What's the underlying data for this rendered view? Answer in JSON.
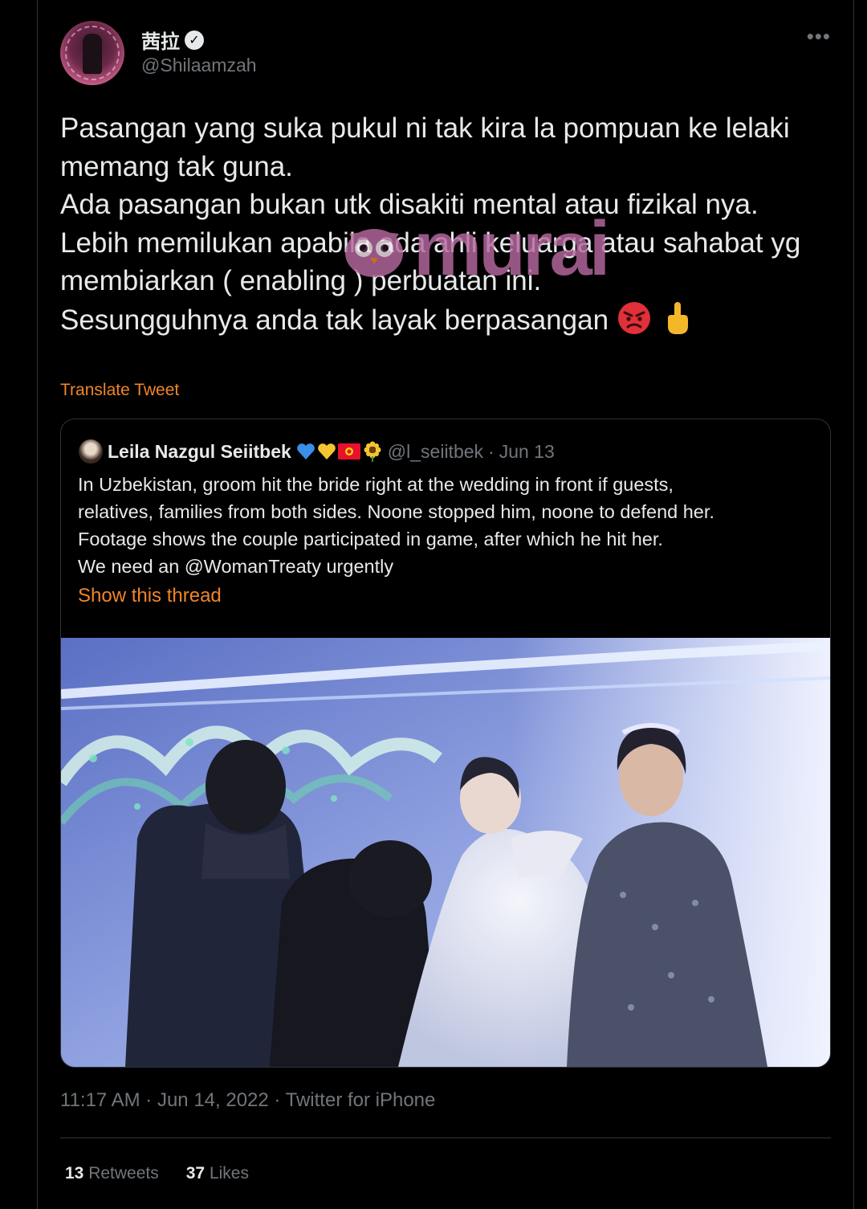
{
  "author": {
    "display_name": "茜拉",
    "handle": "@Shilaamzah",
    "verified": true,
    "avatar_icon": "profile-photo",
    "more_label": "•••"
  },
  "tweet": {
    "lines": [
      "Pasangan yang suka pukul ni tak kira la pompuan ke lelaki memang tak guna.",
      "Ada pasangan bukan utk disakiti mental atau fizikal nya.",
      "Lebih memilukan apabila ada ahli keluarga atau sahabat yg membiarkan ( enabling ) perbuatan ini.",
      "Sesungguhnya anda tak layak berpasangan"
    ],
    "emojis": [
      "angry-face-icon",
      "middle-finger-icon"
    ],
    "translate_label": "Translate Tweet"
  },
  "watermark": {
    "text": "murai",
    "icon": "owl-logo"
  },
  "quoted": {
    "display_name": "Leila Nazgul Seiitbek",
    "name_emojis": [
      "blue-heart-icon",
      "yellow-heart-icon",
      "kyrgyzstan-flag-icon",
      "sunflower-icon"
    ],
    "handle": "@l_seiitbek",
    "separator": "·",
    "date": "Jun 13",
    "lines": [
      "In Uzbekistan, groom hit the bride right at the wedding in front if guests,",
      "relatives, families from both sides. Noone stopped him, noone to defend her.",
      "Footage shows the couple participated in game, after which he hit her.",
      "We need an @WomanTreaty urgently"
    ],
    "show_thread_label": "Show this thread",
    "media": "wedding-video-still"
  },
  "meta": "11:17 AM · Jun 14, 2022 · Twitter for iPhone",
  "stats": {
    "retweets_count": "13",
    "retweets_label": "Retweets",
    "likes_count": "37",
    "likes_label": "Likes"
  },
  "colors": {
    "background": "#000000",
    "text": "#e7e9ea",
    "muted": "#71767b",
    "accent_link": "#f0852a",
    "border": "#2f3336"
  }
}
